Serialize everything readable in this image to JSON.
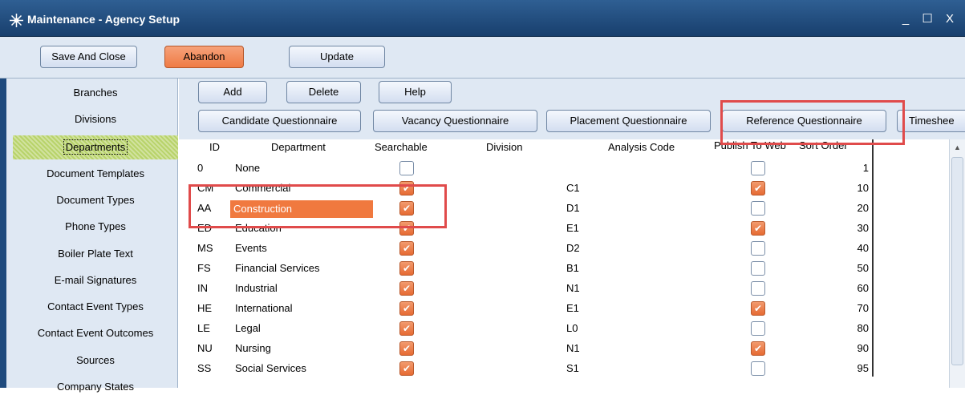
{
  "window": {
    "title": "Maintenance - Agency Setup",
    "controls": [
      "_",
      "☐",
      "X"
    ]
  },
  "toolbar": {
    "save_close": "Save And Close",
    "abandon": "Abandon",
    "update": "Update"
  },
  "sidebar": {
    "items": [
      {
        "label": "Branches"
      },
      {
        "label": "Divisions"
      },
      {
        "label": "Departments"
      },
      {
        "label": "Document Templates"
      },
      {
        "label": "Document Types"
      },
      {
        "label": "Phone Types"
      },
      {
        "label": "Boiler Plate Text"
      },
      {
        "label": "E-mail Signatures"
      },
      {
        "label": "Contact Event Types"
      },
      {
        "label": "Contact Event Outcomes"
      },
      {
        "label": "Sources"
      },
      {
        "label": "Company States"
      }
    ],
    "active_index": 2
  },
  "actions": {
    "add": "Add",
    "delete": "Delete",
    "help": "Help"
  },
  "questionnaires": {
    "candidate": "Candidate Questionnaire",
    "vacancy": "Vacancy Questionnaire",
    "placement": "Placement Questionnaire",
    "reference": "Reference Questionnaire",
    "timesheet": "Timeshee"
  },
  "table": {
    "headers": {
      "id": "ID",
      "department": "Department",
      "searchable": "Searchable",
      "division": "Division",
      "analysis_code": "Analysis Code",
      "publish": "Publish To Web",
      "sort_order": "Sort Order"
    },
    "rows": [
      {
        "id": "0",
        "department": "None",
        "searchable": false,
        "analysis_code": "",
        "publish": false,
        "sort_order": "1"
      },
      {
        "id": "CM",
        "department": "Commercial",
        "searchable": true,
        "analysis_code": "C1",
        "publish": true,
        "sort_order": "10"
      },
      {
        "id": "AA",
        "department": "Construction",
        "searchable": true,
        "analysis_code": "D1",
        "publish": false,
        "sort_order": "20"
      },
      {
        "id": "ED",
        "department": "Education",
        "searchable": true,
        "analysis_code": "E1",
        "publish": true,
        "sort_order": "30"
      },
      {
        "id": "MS",
        "department": "Events",
        "searchable": true,
        "analysis_code": "D2",
        "publish": false,
        "sort_order": "40"
      },
      {
        "id": "FS",
        "department": "Financial Services",
        "searchable": true,
        "analysis_code": "B1",
        "publish": false,
        "sort_order": "50"
      },
      {
        "id": "IN",
        "department": "Industrial",
        "searchable": true,
        "analysis_code": "N1",
        "publish": false,
        "sort_order": "60"
      },
      {
        "id": "HE",
        "department": "International",
        "searchable": true,
        "analysis_code": "E1",
        "publish": true,
        "sort_order": "70"
      },
      {
        "id": "LE",
        "department": "Legal",
        "searchable": true,
        "analysis_code": "L0",
        "publish": false,
        "sort_order": "80"
      },
      {
        "id": "NU",
        "department": "Nursing",
        "searchable": true,
        "analysis_code": "N1",
        "publish": true,
        "sort_order": "90"
      },
      {
        "id": "SS",
        "department": "Social Services",
        "searchable": true,
        "analysis_code": "S1",
        "publish": false,
        "sort_order": "95"
      }
    ],
    "selected_row": 2
  },
  "colors": {
    "titlebar": "#1f4a7d",
    "accent_orange": "#f0793f",
    "annotation_red": "#e04b4b",
    "active_nav": "#b8d36a"
  }
}
